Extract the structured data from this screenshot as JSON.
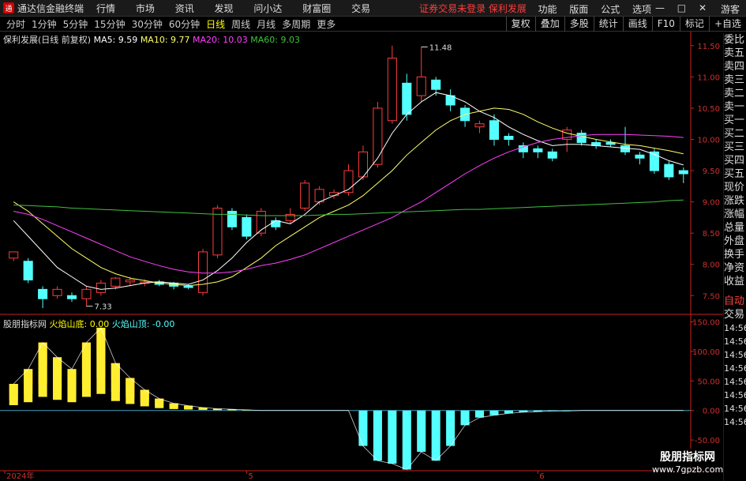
{
  "app": {
    "title": "通达信金融终端",
    "warning": "证券交易未登录 保利发展",
    "guest": "游客"
  },
  "menu": [
    "行情",
    "市场",
    "资讯",
    "发现",
    "问小达",
    "财富圈",
    "交易"
  ],
  "right_menu": [
    "功能",
    "版面",
    "公式",
    "选项"
  ],
  "window_buttons": [
    "—",
    "□",
    "✕"
  ],
  "periods": [
    "分时",
    "1分钟",
    "5分钟",
    "15分钟",
    "30分钟",
    "60分钟",
    "日线",
    "周线",
    "月线",
    "多周期",
    "更多"
  ],
  "active_period": "日线",
  "tools": [
    "复权",
    "叠加",
    "多股",
    "统计",
    "画线",
    "F10",
    "标记",
    "+自选"
  ],
  "main_legend": {
    "stock": "保利发展(日线 前复权)",
    "ma5": "MA5: 9.59",
    "ma10": "MA10: 9.77",
    "ma20": "MA20: 10.03",
    "ma60": "MA60: 9.03"
  },
  "sub_legend": {
    "name": "股朋指标网",
    "bottom": "火焰山底: 0.00",
    "top": "火焰山顶: -0.00"
  },
  "right_panel": [
    "委比",
    "卖五",
    "卖四",
    "卖三",
    "卖二",
    "卖一",
    "买一",
    "买二",
    "买三",
    "买四",
    "买五",
    "现价",
    "涨跌",
    "涨幅",
    "总量",
    "外盘",
    "换手",
    "净资",
    "收益"
  ],
  "right_panel2": [
    "自动",
    "交易",
    "14:56",
    "14:56",
    "14:56",
    "14:56",
    "14:56",
    "14:56",
    "14:56",
    "14:56"
  ],
  "price_axis": {
    "min": 7.2,
    "max": 11.7,
    "ticks": [
      11.5,
      11.0,
      10.5,
      10.0,
      9.5,
      9.0,
      8.5,
      8.0,
      7.5
    ]
  },
  "sub_axis": {
    "min": -102,
    "max": 160,
    "ticks": [
      150.0,
      100.0,
      50.0,
      0.0,
      -50.0
    ]
  },
  "date_labels": [
    {
      "text": "2024年",
      "index": 0
    },
    {
      "text": "5",
      "index": 16
    },
    {
      "text": "6",
      "index": 36
    }
  ],
  "annotations": {
    "high": "11.48",
    "low": "7.33",
    "high_index": 28,
    "low_index": 5
  },
  "candles": [
    [
      8.1,
      8.2,
      8.15,
      8.05
    ],
    [
      8.05,
      7.75,
      8.1,
      7.7
    ],
    [
      7.6,
      7.45,
      7.65,
      7.3
    ],
    [
      7.5,
      7.6,
      7.65,
      7.45
    ],
    [
      7.5,
      7.45,
      7.55,
      7.4
    ],
    [
      7.45,
      7.6,
      7.65,
      7.33
    ],
    [
      7.55,
      7.7,
      7.75,
      7.5
    ],
    [
      7.65,
      7.78,
      7.8,
      7.6
    ],
    [
      7.72,
      7.75,
      7.8,
      7.65
    ],
    [
      7.7,
      7.72,
      7.76,
      7.65
    ],
    [
      7.72,
      7.68,
      7.75,
      7.65
    ],
    [
      7.7,
      7.65,
      7.72,
      7.6
    ],
    [
      7.65,
      7.63,
      7.68,
      7.6
    ],
    [
      7.55,
      8.2,
      8.25,
      7.5
    ],
    [
      8.15,
      8.9,
      8.95,
      8.1
    ],
    [
      8.85,
      8.6,
      8.9,
      8.55
    ],
    [
      8.75,
      8.45,
      8.8,
      8.4
    ],
    [
      8.5,
      8.85,
      8.9,
      8.45
    ],
    [
      8.7,
      8.6,
      8.75,
      8.55
    ],
    [
      8.7,
      8.8,
      8.9,
      8.65
    ],
    [
      8.9,
      9.3,
      9.35,
      8.85
    ],
    [
      9.0,
      9.2,
      9.25,
      8.95
    ],
    [
      9.1,
      9.15,
      9.2,
      9.05
    ],
    [
      9.15,
      9.5,
      9.6,
      9.1
    ],
    [
      9.4,
      9.8,
      9.9,
      9.35
    ],
    [
      9.6,
      10.5,
      10.6,
      9.55
    ],
    [
      10.3,
      11.3,
      11.5,
      10.25
    ],
    [
      10.9,
      10.4,
      11.05,
      10.3
    ],
    [
      10.7,
      11.0,
      11.48,
      10.6
    ],
    [
      10.95,
      10.8,
      11.0,
      10.7
    ],
    [
      10.7,
      10.55,
      10.8,
      10.45
    ],
    [
      10.5,
      10.3,
      10.55,
      10.2
    ],
    [
      10.2,
      10.25,
      10.3,
      10.1
    ],
    [
      10.3,
      10.0,
      10.4,
      9.9
    ],
    [
      10.05,
      10.0,
      10.1,
      9.9
    ],
    [
      9.9,
      9.8,
      9.95,
      9.7
    ],
    [
      9.85,
      9.8,
      9.9,
      9.7
    ],
    [
      9.8,
      9.7,
      9.85,
      9.65
    ],
    [
      10.0,
      10.15,
      10.2,
      9.8
    ],
    [
      10.1,
      9.95,
      10.15,
      9.9
    ],
    [
      9.95,
      9.9,
      10.0,
      9.85
    ],
    [
      9.95,
      9.92,
      10.0,
      9.88
    ],
    [
      9.9,
      9.8,
      10.2,
      9.75
    ],
    [
      9.75,
      9.7,
      9.8,
      9.6
    ],
    [
      9.8,
      9.5,
      9.85,
      9.45
    ],
    [
      9.6,
      9.4,
      9.65,
      9.35
    ],
    [
      9.5,
      9.45,
      9.55,
      9.3
    ]
  ],
  "ma_series": [
    {
      "name": "MA5",
      "color": "#ffffff",
      "values": [
        8.7,
        8.45,
        8.2,
        7.95,
        7.8,
        7.65,
        7.6,
        7.62,
        7.66,
        7.7,
        7.72,
        7.7,
        7.68,
        7.75,
        7.9,
        8.1,
        8.35,
        8.55,
        8.7,
        8.65,
        8.8,
        9.0,
        9.1,
        9.2,
        9.4,
        9.7,
        10.1,
        10.4,
        10.6,
        10.75,
        10.7,
        10.6,
        10.45,
        10.35,
        10.2,
        10.08,
        9.98,
        9.9,
        9.92,
        9.92,
        9.9,
        9.88,
        9.86,
        9.84,
        9.76,
        9.66,
        9.59
      ]
    },
    {
      "name": "MA10",
      "color": "#ffff66",
      "values": [
        9.0,
        8.85,
        8.65,
        8.45,
        8.25,
        8.1,
        7.95,
        7.85,
        7.78,
        7.74,
        7.7,
        7.68,
        7.66,
        7.68,
        7.72,
        7.8,
        7.95,
        8.1,
        8.3,
        8.45,
        8.6,
        8.75,
        8.85,
        8.95,
        9.1,
        9.3,
        9.5,
        9.75,
        9.95,
        10.15,
        10.3,
        10.4,
        10.45,
        10.5,
        10.48,
        10.4,
        10.28,
        10.18,
        10.1,
        10.05,
        10.0,
        9.96,
        9.92,
        9.9,
        9.86,
        9.82,
        9.77
      ]
    },
    {
      "name": "MA20",
      "color": "#ff40ff",
      "values": [
        8.85,
        8.8,
        8.72,
        8.62,
        8.52,
        8.42,
        8.32,
        8.22,
        8.12,
        8.05,
        7.98,
        7.92,
        7.88,
        7.86,
        7.86,
        7.88,
        7.92,
        7.98,
        8.02,
        8.08,
        8.15,
        8.25,
        8.35,
        8.45,
        8.55,
        8.65,
        8.75,
        8.88,
        9.0,
        9.15,
        9.3,
        9.45,
        9.58,
        9.7,
        9.8,
        9.88,
        9.95,
        10.0,
        10.03,
        10.06,
        10.08,
        10.08,
        10.08,
        10.07,
        10.06,
        10.05,
        10.03
      ]
    },
    {
      "name": "MA60",
      "color": "#40c040",
      "values": [
        8.95,
        8.94,
        8.93,
        8.92,
        8.9,
        8.89,
        8.88,
        8.87,
        8.86,
        8.85,
        8.84,
        8.83,
        8.82,
        8.81,
        8.8,
        8.8,
        8.79,
        8.78,
        8.78,
        8.78,
        8.78,
        8.79,
        8.8,
        8.8,
        8.81,
        8.82,
        8.83,
        8.84,
        8.85,
        8.86,
        8.87,
        8.88,
        8.88,
        8.89,
        8.9,
        8.91,
        8.92,
        8.93,
        8.94,
        8.95,
        8.96,
        8.97,
        8.98,
        8.99,
        9.0,
        9.02,
        9.03
      ]
    }
  ],
  "flame_values": [
    45,
    70,
    115,
    90,
    70,
    115,
    140,
    80,
    55,
    35,
    20,
    12,
    8,
    5,
    3,
    2,
    1,
    0,
    0,
    0,
    0,
    0,
    0,
    0,
    -60,
    -85,
    -90,
    -100,
    -70,
    -85,
    -60,
    -25,
    -12,
    -8,
    -5,
    -3,
    -2,
    -1,
    -1,
    0,
    0,
    0,
    0,
    0,
    0,
    0,
    0
  ],
  "colors": {
    "up": "#ff3c3c",
    "down": "#54ffff",
    "axis": "#cc2020",
    "ma60": "#40c040"
  }
}
